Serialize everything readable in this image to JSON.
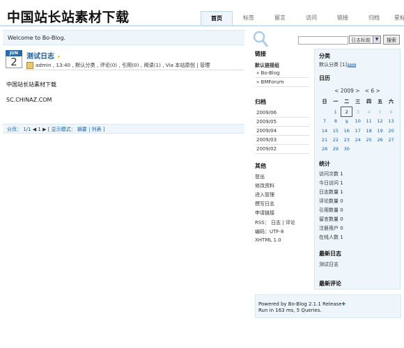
{
  "site": {
    "title": "中国站长站素材下载"
  },
  "nav": [
    "首页",
    "标签",
    "留言",
    "访问",
    "链接",
    "归档",
    "星标日志"
  ],
  "welcome": "Welcome to Bo-Blog.",
  "search": {
    "select_value": "日志标题",
    "button_label": "搜索"
  },
  "post": {
    "month": "JUN",
    "day": "2",
    "title": "测试日志",
    "meta": "admin , 13:40 , 默认分类 , 评论(0) , 引用(0) , 阅读(1) , Via 本站原创 | 管理",
    "body1": "中国站长站素材下载",
    "body2": "SC.CHINAZ.COM"
  },
  "pager": {
    "text": "分页： 1/1",
    "page": "1",
    "mode": "[ 显示模式： 摘要 | 列表 ]"
  },
  "links": {
    "title": "链接",
    "subtitle": "默认链接组",
    "items": [
      "Bo-Blog",
      "BMForum"
    ]
  },
  "archives": {
    "title": "归档",
    "items": [
      "2009/06",
      "2009/05",
      "2009/04",
      "2009/03",
      "2009/02"
    ]
  },
  "other": {
    "title": "其他",
    "items": [
      "登出",
      "修改资料",
      "进入管理",
      "撰写日志",
      "申请链接",
      "RSS： 日志 | 评论",
      "编码：UTF-8",
      "XHTML 1.0"
    ]
  },
  "categories": {
    "title": "分类",
    "item": "默认分类 [1]",
    "rss": "RSS"
  },
  "calendar": {
    "title": "日历",
    "year": "< 2009 >",
    "month": "< 6 >",
    "weekdays": [
      "日",
      "一",
      "二",
      "三",
      "四",
      "五",
      "六"
    ],
    "rows": [
      [
        "",
        "1",
        "2",
        "3",
        "4",
        "5",
        "6"
      ],
      [
        "7",
        "8",
        "9",
        "10",
        "11",
        "12",
        "13"
      ],
      [
        "14",
        "15",
        "16",
        "17",
        "18",
        "19",
        "20"
      ],
      [
        "21",
        "22",
        "23",
        "24",
        "25",
        "26",
        "27"
      ],
      [
        "28",
        "29",
        "30",
        "",
        "",
        "",
        ""
      ]
    ]
  },
  "stats": {
    "title": "统计",
    "items": [
      "访问次数 1",
      "今日访问 1",
      "日志数量 1",
      "评论数量 0",
      "引用数量 0",
      "留言数量 0",
      "注册用户 0",
      "在线人数 1"
    ]
  },
  "recent_posts": {
    "title": "最新日志",
    "items": [
      "测试日志"
    ]
  },
  "recent_comments": {
    "title": "最新评论"
  },
  "footer": {
    "line1": "Powered by Bo-Blog 2.1.1 Release",
    "line2": "Run in 163 ms, 5 Queries."
  },
  "colors": {
    "accent": "#1a5fa3",
    "panel": "#eef6fb"
  }
}
